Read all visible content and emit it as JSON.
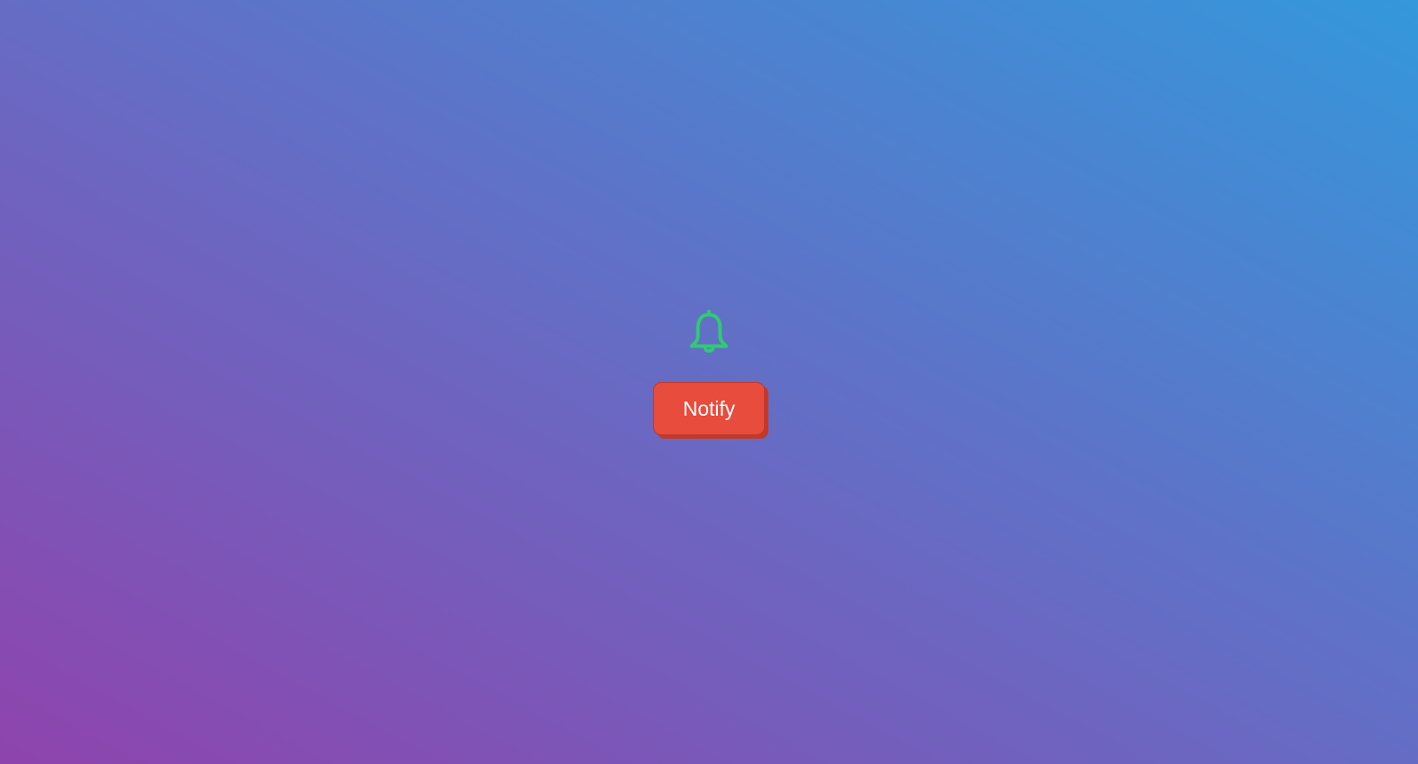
{
  "page": {
    "background_colors": [
      "#8e44ad",
      "#6a68c2",
      "#3498db"
    ]
  },
  "notification": {
    "icon": "bell-icon",
    "icon_color": "#2ecc71",
    "button_label": "Notify",
    "button_color": "#e74c3c",
    "button_shadow_color": "#c0392b"
  }
}
